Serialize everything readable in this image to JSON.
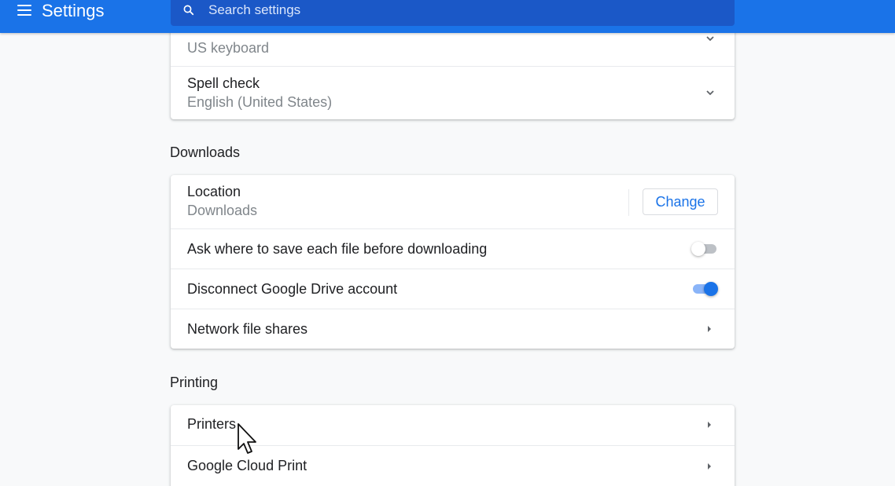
{
  "topbar": {
    "title": "Settings",
    "search_placeholder": "Search settings"
  },
  "languages_card": {
    "keyboard_value": "US keyboard",
    "spell_check_label": "Spell check",
    "spell_check_value": "English (United States)"
  },
  "downloads": {
    "section_title": "Downloads",
    "location_label": "Location",
    "location_value": "Downloads",
    "change_label": "Change",
    "ask_where_label": "Ask where to save each file before downloading",
    "ask_where_enabled": false,
    "disconnect_drive_label": "Disconnect Google Drive account",
    "disconnect_drive_enabled": true,
    "network_shares_label": "Network file shares"
  },
  "printing": {
    "section_title": "Printing",
    "printers_label": "Printers",
    "cloud_print_label": "Google Cloud Print"
  },
  "icons": {
    "menu": "menu-icon",
    "search": "search-icon",
    "chevron": "chevron-down-icon",
    "arrow": "arrow-right-icon",
    "cursor": "mouse-pointer-icon"
  },
  "colors": {
    "accent": "#1a73e8",
    "topbar": "#1a73e8",
    "background": "#f8f9fa"
  }
}
